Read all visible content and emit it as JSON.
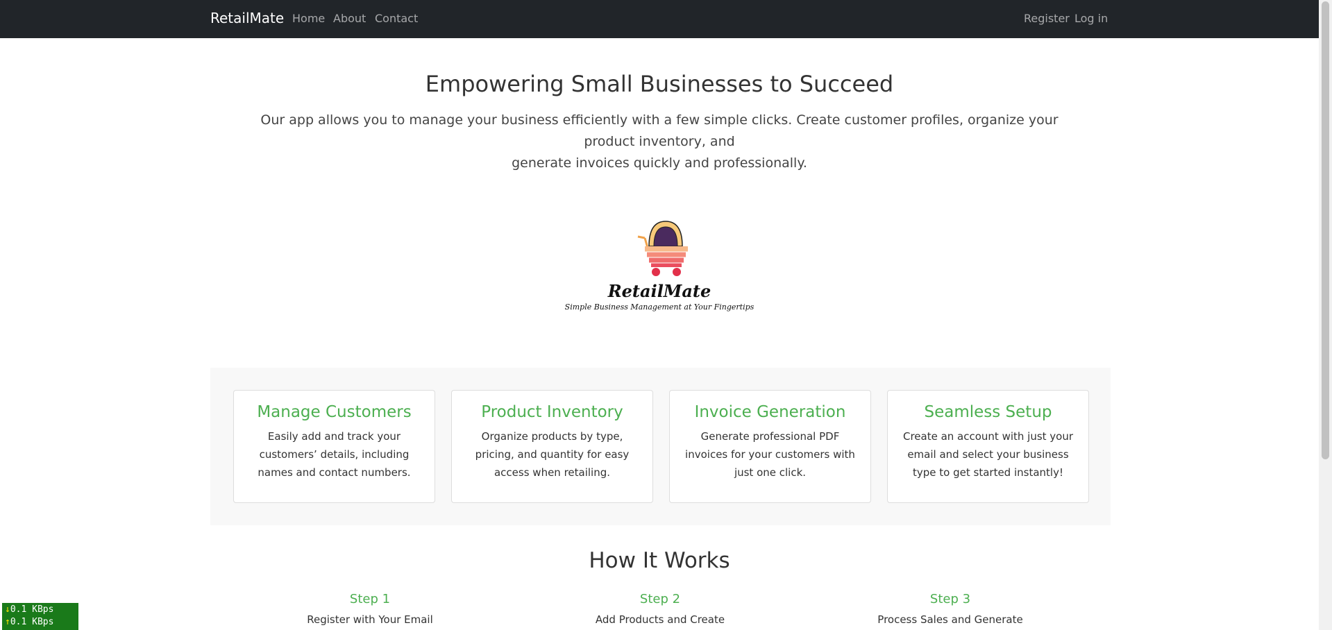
{
  "navbar": {
    "brand": "RetailMate",
    "links": [
      "Home",
      "About",
      "Contact"
    ],
    "auth": {
      "register": "Register",
      "login": "Log in"
    }
  },
  "hero": {
    "title": "Empowering Small Businesses to Succeed",
    "text_line1": "Our app allows you to manage your business efficiently with a few simple clicks. Create customer profiles, organize your product inventory, and",
    "text_line2": "generate invoices quickly and professionally."
  },
  "logo": {
    "name": "RetailMate",
    "tagline": "Simple Business Management at Your Fingertips",
    "icon": "shopping-cart-icon"
  },
  "features": [
    {
      "title": "Manage Customers",
      "text": "Easily add and track your customers’ details, including names and contact numbers."
    },
    {
      "title": "Product Inventory",
      "text": "Organize products by type, pricing, and quantity for easy access when retailing."
    },
    {
      "title": "Invoice Generation",
      "text": "Generate professional PDF invoices for your customers with just one click."
    },
    {
      "title": "Seamless Setup",
      "text": "Create an account with just your email and select your business type to get started instantly!"
    }
  ],
  "how_it_works": {
    "title": "How It Works",
    "steps": [
      {
        "title": "Step 1",
        "text": "Register with Your Email"
      },
      {
        "title": "Step 2",
        "text": "Add Products and Create"
      },
      {
        "title": "Step 3",
        "text": "Process Sales and Generate"
      }
    ]
  },
  "net_monitor": {
    "down": "0.1 KBps",
    "up": "0.1 KBps"
  },
  "colors": {
    "navbar": "#212529",
    "accent_green": "#4caf50",
    "features_bg": "#f8f8f8"
  }
}
